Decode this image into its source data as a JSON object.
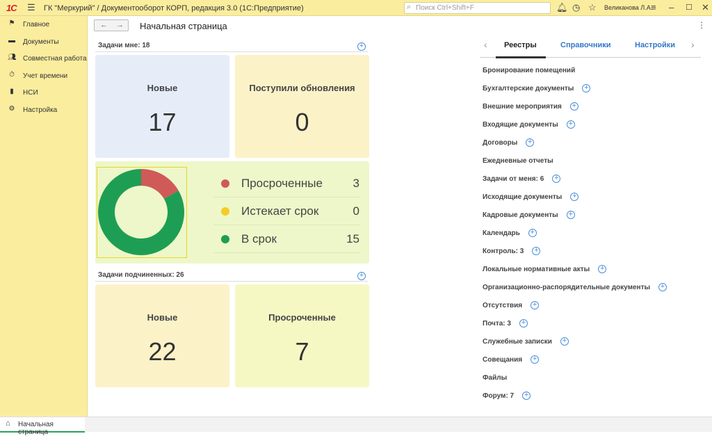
{
  "titlebar": {
    "logo": "1С",
    "title": "ГК \"Меркурий\" / Документооборот КОРП, редакция 3.0  (1С:Предприятие)",
    "search_placeholder": "Поиск Ctrl+Shift+F",
    "user": "Великанова Л.А."
  },
  "sidebar": {
    "items": [
      {
        "label": "Главное",
        "icon": "flag-icon"
      },
      {
        "label": "Документы",
        "icon": "folder-icon"
      },
      {
        "label": "Совместная работа",
        "icon": "people-icon"
      },
      {
        "label": "Учет времени",
        "icon": "clock-icon"
      },
      {
        "label": "НСИ",
        "icon": "book-icon"
      },
      {
        "label": "Настройка",
        "icon": "settings-icon"
      }
    ]
  },
  "page": {
    "title": "Начальная страница"
  },
  "my_tasks": {
    "header": "Задачи мне: 18",
    "tiles": [
      {
        "label": "Новые",
        "value": "17",
        "color": "#e6edf9"
      },
      {
        "label": "Поступили обновления",
        "value": "0",
        "color": "#fcf2c8"
      }
    ],
    "status": [
      {
        "label": "Просроченные",
        "value": "3",
        "color": "#d05a58"
      },
      {
        "label": "Истекает срок",
        "value": "0",
        "color": "#f4cc27"
      },
      {
        "label": "В срок",
        "value": "15",
        "color": "#1e9e54"
      }
    ]
  },
  "sub_tasks": {
    "header": "Задачи подчиненных: 26",
    "tiles": [
      {
        "label": "Новые",
        "value": "22",
        "color": "#fcf2c8"
      },
      {
        "label": "Просроченные",
        "value": "7",
        "color": "#f6f8c4"
      }
    ]
  },
  "tabs": [
    "Реестры",
    "Справочники",
    "Настройки"
  ],
  "registers": [
    {
      "label": "Бронирование помещений",
      "plus": false
    },
    {
      "label": "Бухгалтерские документы",
      "plus": true
    },
    {
      "label": "Внешние мероприятия",
      "plus": true
    },
    {
      "label": "Входящие документы",
      "plus": true
    },
    {
      "label": "Договоры",
      "plus": true
    },
    {
      "label": "Ежедневные отчеты",
      "plus": false
    },
    {
      "label": "Задачи от меня: 6",
      "plus": true
    },
    {
      "label": "Исходящие документы",
      "plus": true
    },
    {
      "label": "Кадровые документы",
      "plus": true
    },
    {
      "label": "Календарь",
      "plus": true
    },
    {
      "label": "Контроль: 3",
      "plus": true
    },
    {
      "label": "Локальные нормативные акты",
      "plus": true
    },
    {
      "label": "Организационно-распорядительные документы",
      "plus": true
    },
    {
      "label": "Отсутствия",
      "plus": true
    },
    {
      "label": "Почта: 3",
      "plus": true
    },
    {
      "label": "Служебные записки",
      "plus": true
    },
    {
      "label": "Совещания",
      "plus": true
    },
    {
      "label": "Файлы",
      "plus": false
    },
    {
      "label": "Форум: 7",
      "plus": true
    }
  ],
  "bottom_tab": "Начальная страница"
}
